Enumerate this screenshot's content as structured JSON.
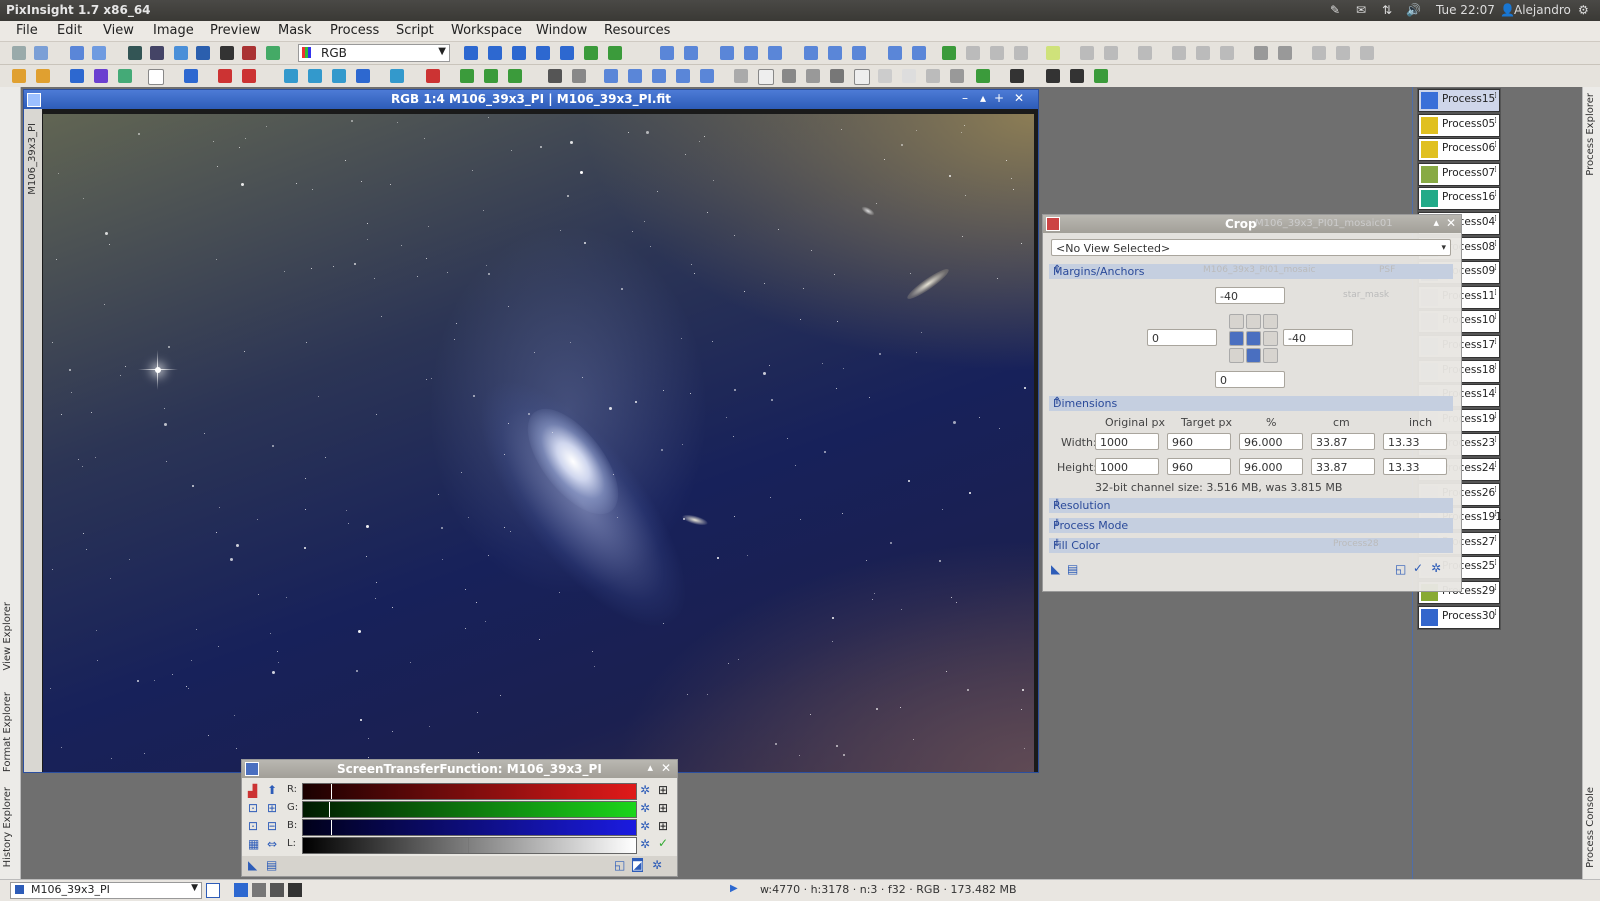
{
  "app": {
    "title": "PixInsight 1.7 x86_64"
  },
  "system": {
    "time": "Tue 22:07",
    "user": "Alejandro"
  },
  "menu": [
    "File",
    "Edit",
    "View",
    "Image",
    "Preview",
    "Mask",
    "Process",
    "Script",
    "Workspace",
    "Window",
    "Resources"
  ],
  "toolbar": {
    "channel_select": "RGB"
  },
  "image_window": {
    "title": "RGB 1:4 M106_39x3_PI | M106_39x3_PI.fit",
    "side_label": "M106_39x3_PI"
  },
  "left_dock": {
    "tabs": [
      "View Explorer",
      "Format Explorer",
      "History Explorer"
    ]
  },
  "right_dock": {
    "tabs": [
      "Process Explorer",
      "Process Console"
    ]
  },
  "crop": {
    "title": "Crop",
    "view_selector": "<No View Selected>",
    "sections": {
      "margins": "Margins/Anchors",
      "dimensions": "Dimensions",
      "resolution": "Resolution",
      "process_mode": "Process Mode",
      "fill_color": "Fill Color"
    },
    "margins": {
      "top": "-40",
      "left": "0",
      "right": "-40",
      "bottom": "0"
    },
    "dims_headers": [
      "Original px",
      "Target px",
      "%",
      "cm",
      "inch"
    ],
    "width": {
      "label": "Width:",
      "original": "1000",
      "target": "960",
      "percent": "96.000",
      "cm": "33.87",
      "inch": "13.33"
    },
    "height": {
      "label": "Height:",
      "original": "1000",
      "target": "960",
      "percent": "96.000",
      "cm": "33.87",
      "inch": "13.33"
    },
    "info": "32-bit channel size: 3.516 MB, was 3.815 MB",
    "ghost_labels": [
      "M106_39x3_PI01_mosaic01",
      "M106_39x3_PI01_mosaic",
      "PSF",
      "star_mask",
      "Process28"
    ]
  },
  "processes": [
    "Process15",
    "Process05",
    "Process06",
    "Process07",
    "Process16",
    "Process04",
    "Process08",
    "Process09",
    "Process11",
    "Process10",
    "Process17",
    "Process18",
    "Process14",
    "Process19",
    "Process23",
    "Process24",
    "Process26",
    "Process191",
    "Process27",
    "Process25",
    "Process29",
    "Process30"
  ],
  "stf": {
    "title": "ScreenTransferFunction: M106_39x3_PI",
    "channels": [
      "R:",
      "G:",
      "B:",
      "L:"
    ]
  },
  "status": {
    "view": "M106_39x3_PI",
    "info": "w:4770 · h:3178 · n:3 · f32 · RGB · 173.482 MB"
  },
  "colors": {
    "accent": "#2d5cb8",
    "section": "#2a4a9a"
  }
}
